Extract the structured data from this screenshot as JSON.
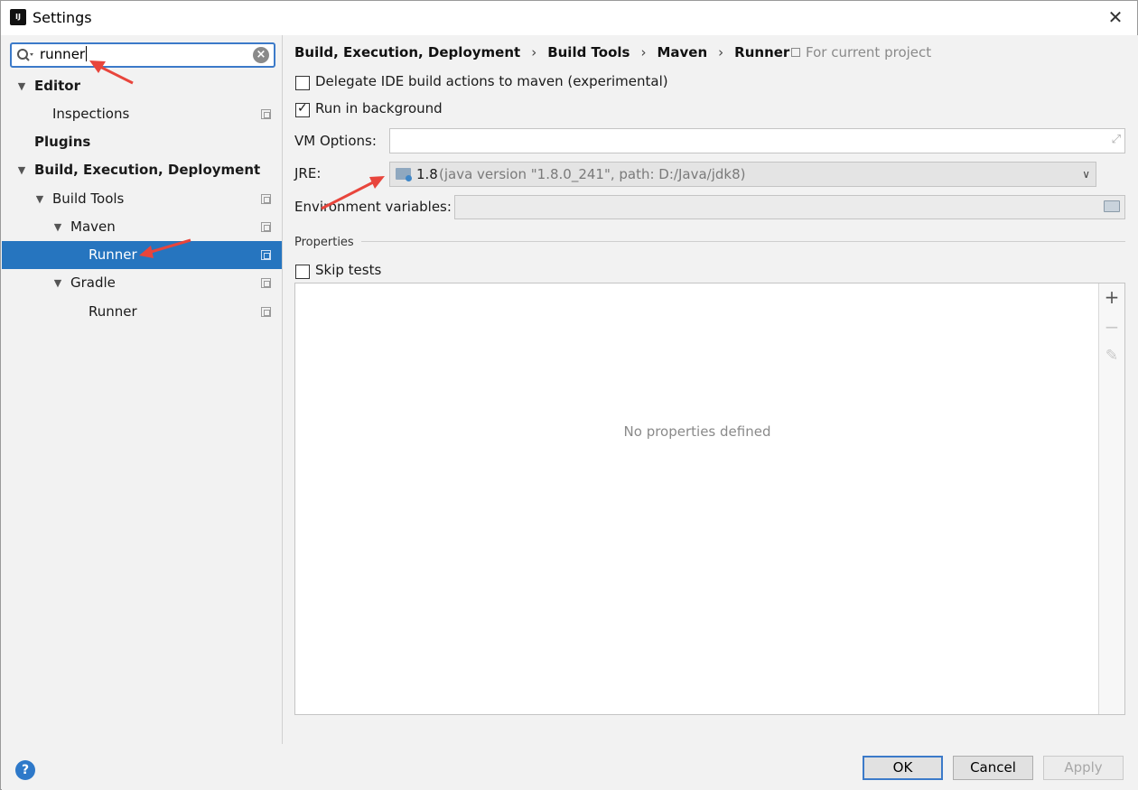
{
  "window": {
    "title": "Settings",
    "close_glyph": "✕"
  },
  "search": {
    "value": "runner",
    "clear_glyph": "×"
  },
  "tree": {
    "editor": "Editor",
    "inspections": "Inspections",
    "plugins": "Plugins",
    "build_exec": "Build, Execution, Deployment",
    "build_tools": "Build Tools",
    "maven": "Maven",
    "maven_runner": "Runner",
    "gradle": "Gradle",
    "gradle_runner": "Runner"
  },
  "breadcrumb": {
    "items": [
      "Build, Execution, Deployment",
      "Build Tools",
      "Maven",
      "Runner"
    ],
    "separator": "›",
    "scope": "For current project"
  },
  "options": {
    "delegate": {
      "label": "Delegate IDE build actions to maven (experimental)",
      "checked": false
    },
    "background": {
      "label": "Run in background",
      "checked": true
    },
    "vm_options_label": "VM Options:",
    "vm_options_value": "",
    "jre_label": "JRE:",
    "jre_version": "1.8",
    "jre_detail": "(java version \"1.8.0_241\", path: D:/Java/jdk8)",
    "env_label": "Environment variables:",
    "env_value": ""
  },
  "properties": {
    "section_title": "Properties",
    "skip_tests": {
      "label": "Skip tests",
      "checked": false
    },
    "empty_text": "No properties defined",
    "toolbar": {
      "add": "+",
      "remove": "−",
      "edit": "✎"
    }
  },
  "footer": {
    "help": "?",
    "ok": "OK",
    "cancel": "Cancel",
    "apply": "Apply"
  },
  "colors": {
    "selection": "#2675bf",
    "focus_border": "#3c7ac9",
    "annotation_arrow": "#e8453c"
  },
  "icons": [
    "search-icon",
    "clear-icon",
    "chevron-down-icon",
    "copy-icon",
    "folder-icon",
    "expand-icon",
    "help-icon",
    "add-icon",
    "remove-icon",
    "edit-icon"
  ]
}
